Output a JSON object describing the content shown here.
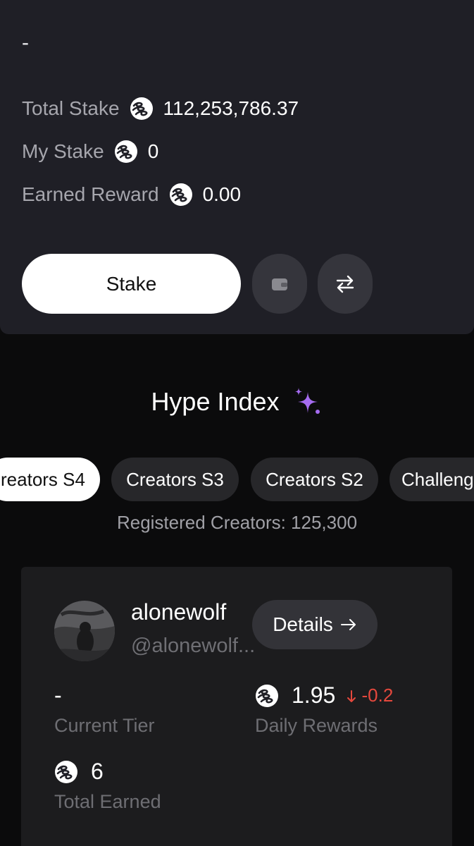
{
  "stake_panel": {
    "header_value": "-",
    "total_stake": {
      "label": "Total Stake",
      "value": "112,253,786.37"
    },
    "my_stake": {
      "label": "My Stake",
      "value": "0"
    },
    "earned_reward": {
      "label": "Earned Reward",
      "value": "0.00"
    },
    "stake_button": "Stake",
    "icons": {
      "wallet": "wallet-icon",
      "swap": "swap-arrows-icon",
      "coin": "token-coin-icon"
    }
  },
  "hype_index": {
    "title": "Hype Index",
    "title_icon": "sparkles-icon",
    "tabs": [
      {
        "label": "reators S4",
        "active": true
      },
      {
        "label": "Creators S3",
        "active": false
      },
      {
        "label": "Creators S2",
        "active": false
      },
      {
        "label": "Challeng",
        "active": false
      }
    ],
    "registered_text": "Registered Creators: 125,300"
  },
  "creator": {
    "name": "alonewolf",
    "handle": "@alonewolf...",
    "details_button": "Details",
    "details_icon": "arrow-right-icon",
    "current_tier": {
      "value": "-",
      "label": "Current Tier"
    },
    "daily_rewards": {
      "value": "1.95",
      "delta": "-0.2",
      "label": "Daily Rewards"
    },
    "total_earned": {
      "value": "6",
      "label": "Total Earned"
    }
  },
  "colors": {
    "accent_sparkle": "#a56cf0",
    "negative": "#e5483d",
    "card_bg": "#1f1f26"
  }
}
